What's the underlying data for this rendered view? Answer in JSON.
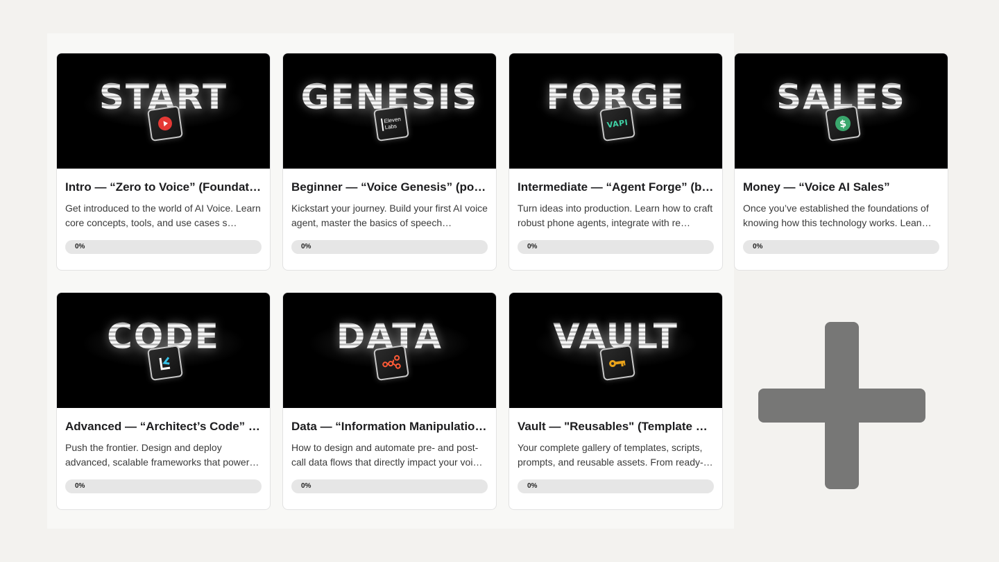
{
  "courses": [
    {
      "id": "intro",
      "banner_word": "START",
      "icon": "youtube-play-icon",
      "title": "Intro — “Zero to Voice” (Foundations)",
      "description": "Get introduced to the world of AI Voice. Learn core concepts, tools, and use cases s…",
      "progress_label": "0%",
      "progress_fraction": 0
    },
    {
      "id": "beginner",
      "banner_word": "GENESIS",
      "icon": "elevenlabs-icon",
      "icon_text": "Eleven Labs",
      "title": "Beginner — “Voice Genesis” (pow…",
      "description": "Kickstart your journey. Build your first AI voice agent, master the basics of speech…",
      "progress_label": "0%",
      "progress_fraction": 0
    },
    {
      "id": "intermediate",
      "banner_word": "FORGE",
      "icon": "vapi-icon",
      "icon_text": "VAPI",
      "title": "Intermediate — “Agent Forge” (bui…",
      "description": "Turn ideas into production. Learn how to craft robust phone agents, integrate with re…",
      "progress_label": "0%",
      "progress_fraction": 0
    },
    {
      "id": "money",
      "banner_word": "SALES",
      "icon": "dollar-icon",
      "title": "Money — “Voice AI Sales”",
      "description": "Once you’ve established the foundations of knowing how this technology works. Lean…",
      "progress_label": "0%",
      "progress_fraction": 0
    },
    {
      "id": "advanced",
      "banner_word": "CODE",
      "icon": "code-bracket-icon",
      "title": "Advanced — “Architect’s Code” (w…",
      "description": "Push the frontier. Design and deploy advanced, scalable frameworks that power…",
      "progress_label": "0%",
      "progress_fraction": 0
    },
    {
      "id": "data",
      "banner_word": "DATA",
      "icon": "workflow-nodes-icon",
      "title": "Data — “Information Manipulation…",
      "description": "How to design and automate pre- and post-call data flows that directly impact your voi…",
      "progress_label": "0%",
      "progress_fraction": 0
    },
    {
      "id": "vault",
      "banner_word": "VAULT",
      "icon": "key-icon",
      "title": "Vault — \"Reusables\" (Template Ga…",
      "description": "Your complete gallery of templates, scripts, prompts, and reusable assets. From ready-t…",
      "progress_label": "0%",
      "progress_fraction": 0
    }
  ],
  "add_button": {
    "icon": "plus-icon"
  },
  "colors": {
    "page_bg": "#f3f2ef",
    "card_bg": "#ffffff",
    "progress_track": "#e6e6e6",
    "plus": "#777776",
    "youtube_red": "#e53935",
    "vapi_teal": "#3fd1a5",
    "dollar_green": "#3aa76d",
    "data_orange": "#ff5a36",
    "key_gold": "#e8a21a",
    "code_blue": "#37c3e8"
  }
}
